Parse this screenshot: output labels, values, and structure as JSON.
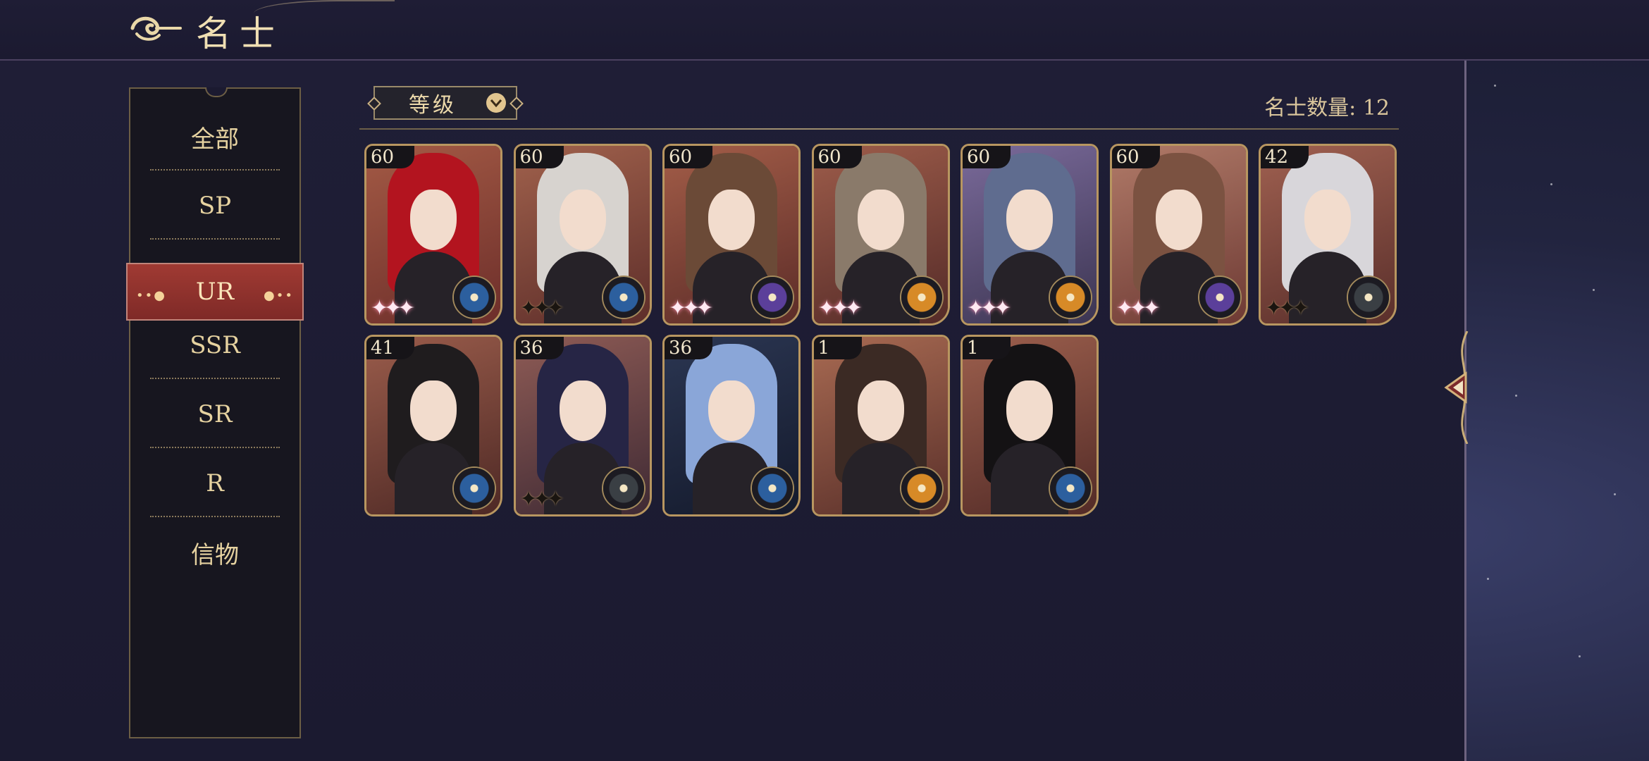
{
  "header": {
    "title": "名士"
  },
  "sidebar": {
    "tabs": [
      {
        "label": "全部",
        "active": false
      },
      {
        "label": "SP",
        "active": false
      },
      {
        "label": "UR",
        "active": true
      },
      {
        "label": "SSR",
        "active": false
      },
      {
        "label": "SR",
        "active": false
      },
      {
        "label": "R",
        "active": false
      },
      {
        "label": "信物",
        "active": false
      }
    ]
  },
  "toolbar": {
    "sort_label": "等级",
    "count_label": "名士数量: 12"
  },
  "colors": {
    "accent_red": "#9a3530",
    "gold": "#b89660",
    "emblem_blue": "#2c5f9e",
    "emblem_purple": "#5b3f9a",
    "emblem_orange": "#d78a27",
    "emblem_gray": "#3a3f44"
  },
  "cards": [
    {
      "level": "60",
      "emblem": "blue-compass-icon",
      "sparkle": "pink-sparkle"
    },
    {
      "level": "60",
      "emblem": "blue-compass-icon",
      "sparkle": "dark-sparkle"
    },
    {
      "level": "60",
      "emblem": "purple-planet-icon",
      "sparkle": "pink-sparkle"
    },
    {
      "level": "60",
      "emblem": "orange-sun-icon",
      "sparkle": "pink-sparkle"
    },
    {
      "level": "60",
      "emblem": "orange-sun-icon",
      "sparkle": "pink-sparkle"
    },
    {
      "level": "60",
      "emblem": "purple-planet-icon",
      "sparkle": "pink-sparkle"
    },
    {
      "level": "42",
      "emblem": "gray-compass-icon",
      "sparkle": "dark-sparkle"
    },
    {
      "level": "41",
      "emblem": "blue-compass-icon",
      "sparkle": "none"
    },
    {
      "level": "36",
      "emblem": "gray-compass-icon",
      "sparkle": "dark-sparkle"
    },
    {
      "level": "36",
      "emblem": "blue-compass-icon",
      "sparkle": "none"
    },
    {
      "level": "1",
      "emblem": "orange-sun-icon",
      "sparkle": "none"
    },
    {
      "level": "1",
      "emblem": "blue-compass-icon",
      "sparkle": "none"
    }
  ]
}
